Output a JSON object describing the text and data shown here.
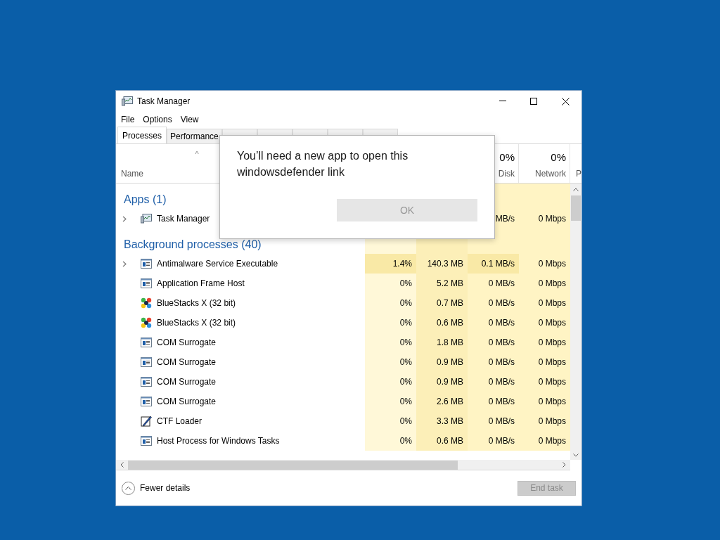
{
  "window": {
    "title": "Task Manager"
  },
  "menu": [
    "File",
    "Options",
    "View"
  ],
  "tabs": [
    {
      "label": "Processes",
      "selected": true
    },
    {
      "label": "Performance",
      "selected": false
    },
    {
      "selected": false
    },
    {
      "selected": false
    },
    {
      "selected": false
    },
    {
      "selected": false
    },
    {
      "selected": false
    }
  ],
  "columns": [
    {
      "header": "Name",
      "sort_caret": "^"
    },
    {
      "header": "Disk",
      "total": "0%"
    },
    {
      "header": "Network",
      "total": "0%"
    },
    {
      "header": "P"
    }
  ],
  "groups": [
    {
      "title": "Apps (1)",
      "rows": [
        {
          "name": "Task Manager",
          "kind": "monitor",
          "expandable": true,
          "busy": false,
          "disk": "MB/s",
          "network": "0 Mbps"
        }
      ]
    },
    {
      "title": "Background processes (40)",
      "rows": [
        {
          "name": "Antimalware Service Executable",
          "kind": "window",
          "expandable": true,
          "busy": true,
          "cpu": "1.4%",
          "memory": "140.3 MB",
          "disk": "0.1 MB/s",
          "network": "0 Mbps"
        },
        {
          "name": "Application Frame Host",
          "kind": "window",
          "expandable": false,
          "busy": false,
          "cpu": "0%",
          "memory": "5.2 MB",
          "disk": "0 MB/s",
          "network": "0 Mbps"
        },
        {
          "name": "BlueStacks X (32 bit)",
          "kind": "bluestacks",
          "expandable": false,
          "busy": false,
          "cpu": "0%",
          "memory": "0.7 MB",
          "disk": "0 MB/s",
          "network": "0 Mbps"
        },
        {
          "name": "BlueStacks X (32 bit)",
          "kind": "bluestacks",
          "expandable": false,
          "busy": false,
          "cpu": "0%",
          "memory": "0.6 MB",
          "disk": "0 MB/s",
          "network": "0 Mbps"
        },
        {
          "name": "COM Surrogate",
          "kind": "window",
          "expandable": false,
          "busy": false,
          "cpu": "0%",
          "memory": "1.8 MB",
          "disk": "0 MB/s",
          "network": "0 Mbps"
        },
        {
          "name": "COM Surrogate",
          "kind": "window",
          "expandable": false,
          "busy": false,
          "cpu": "0%",
          "memory": "0.9 MB",
          "disk": "0 MB/s",
          "network": "0 Mbps"
        },
        {
          "name": "COM Surrogate",
          "kind": "window",
          "expandable": false,
          "busy": false,
          "cpu": "0%",
          "memory": "0.9 MB",
          "disk": "0 MB/s",
          "network": "0 Mbps"
        },
        {
          "name": "COM Surrogate",
          "kind": "window",
          "expandable": false,
          "busy": false,
          "cpu": "0%",
          "memory": "2.6 MB",
          "disk": "0 MB/s",
          "network": "0 Mbps"
        },
        {
          "name": "CTF Loader",
          "kind": "pen",
          "expandable": false,
          "busy": false,
          "cpu": "0%",
          "memory": "3.3 MB",
          "disk": "0 MB/s",
          "network": "0 Mbps"
        },
        {
          "name": "Host Process for Windows Tasks",
          "kind": "window",
          "expandable": false,
          "busy": false,
          "cpu": "0%",
          "memory": "0.6 MB",
          "disk": "0 MB/s",
          "network": "0 Mbps"
        }
      ]
    }
  ],
  "footer": {
    "toggle": "Fewer details",
    "end_task": {
      "label": "End task",
      "disabled": true
    }
  },
  "dialog": {
    "message": "You’ll need a new app to open this windowsdefender link",
    "button": {
      "label": "OK",
      "disabled": true
    }
  }
}
